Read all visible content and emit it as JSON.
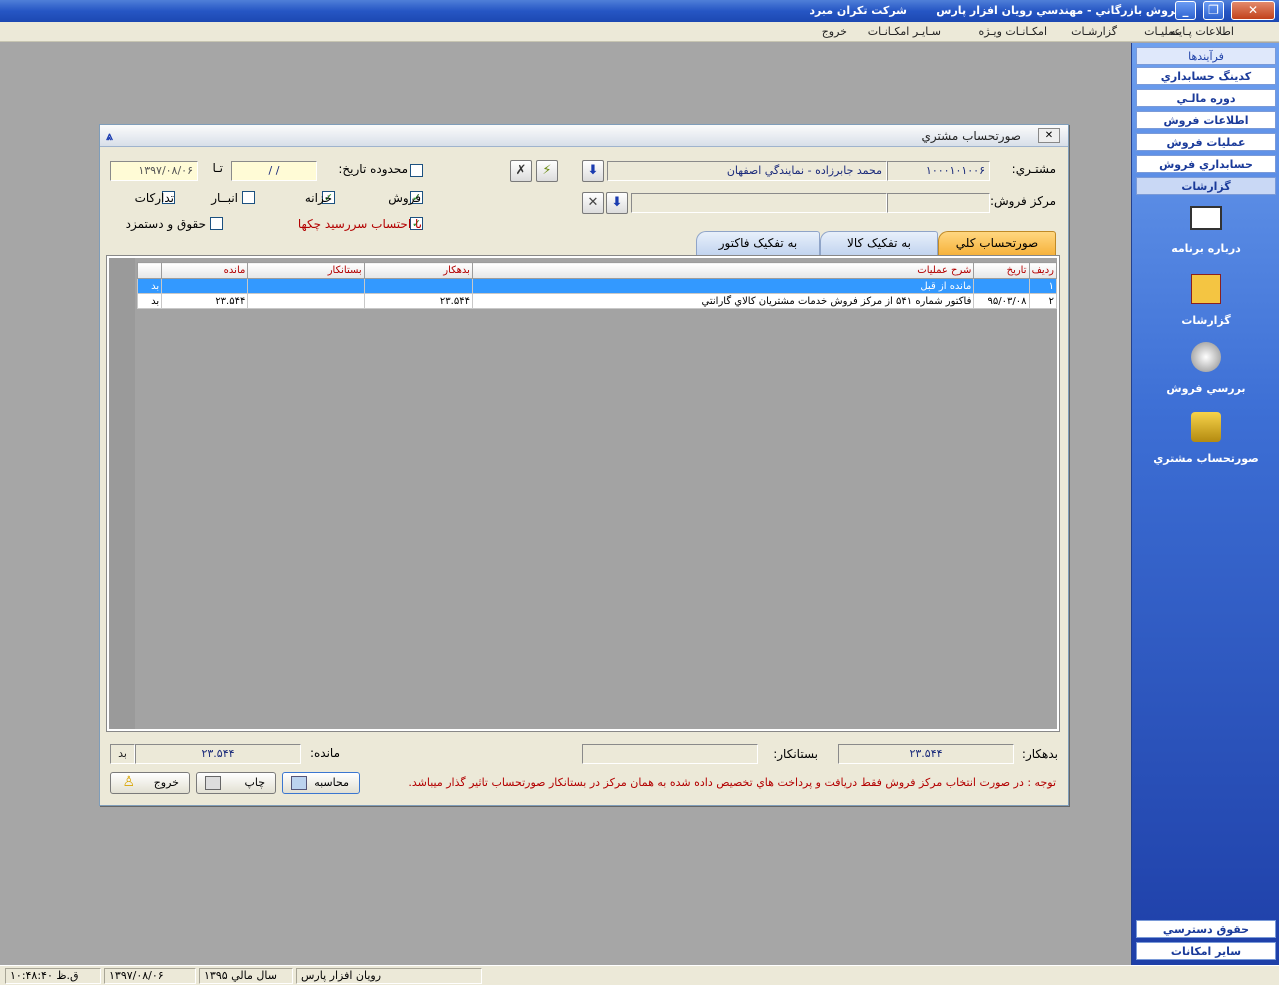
{
  "window": {
    "title": "فروش بازرگاني - مهندسي رويان افزار پارس",
    "company": "شرکت تکران مبرد"
  },
  "menu": [
    "اطلاعات پـايـه",
    "عمليـات",
    "گزارشـات",
    "امکـانـات ويـژه",
    "سـايـر امکـانـات",
    "خروج"
  ],
  "sidebar": {
    "header": "فرآيندها",
    "items": [
      "کدينگ حسابداري",
      "دوره مالـي",
      "اطلاعات فروش",
      "عمليات فروش",
      "حسابداري فروش",
      "گزارشات"
    ],
    "icons": [
      {
        "label": "درباره برنامه",
        "icon": "about-icon"
      },
      {
        "label": "گزارشات",
        "icon": "reports-icon"
      },
      {
        "label": "بررسي فروش",
        "icon": "sales-review-icon"
      },
      {
        "label": "صورتحساب مشتري",
        "icon": "customer-statement-icon"
      }
    ],
    "bottom": [
      "حقوق دسترسي",
      "ساير امکانات"
    ]
  },
  "dialog": {
    "title": "صورتحساب مشتري",
    "customer_label": "مشتـري:",
    "customer_code": "۱۰۰۰۱۰۱۰۰۶",
    "customer_name": "محمد جابرزاده - نمايندگي اصفهان",
    "center_label": "مرکز فروش:",
    "center_code": "",
    "center_name": "",
    "date_range_label": "محدوده تاريخ:",
    "date_from": " /  / ",
    "to_label": "تـا",
    "date_to": "۱۳۹۷/۰۸/۰۶",
    "checks": [
      {
        "label": "فروش",
        "checked": true
      },
      {
        "label": "خزانه",
        "checked": true
      },
      {
        "label": "انبــار",
        "checked": false
      },
      {
        "label": "تدارکات",
        "checked": false
      },
      {
        "label": "با احتساب سررسيد چکها",
        "checked": true
      },
      {
        "label": "حقوق و دستمزد",
        "checked": false
      }
    ],
    "tabs": [
      "صورتحساب کلي",
      "به تفکيک کالا",
      "به تفکيک فاکتور"
    ],
    "grid": {
      "columns": [
        "رديف",
        "تاريخ",
        "شرح عمليات",
        "بدهکار",
        "بستانکار",
        "مانده",
        ""
      ],
      "rows": [
        [
          "۱",
          "",
          "مانده از قبل",
          "",
          "",
          "",
          "بد"
        ],
        [
          "۲",
          "۹۵/۰۳/۰۸",
          "فاکتور شماره ۵۴۱ از مرکز فروش خدمات مشتريان کالاي گارانتي",
          "۲۳.۵۴۴",
          "",
          "۲۳.۵۴۴",
          "بد"
        ]
      ]
    },
    "debit_label": "بدهکار:",
    "debit_value": "۲۳.۵۴۴",
    "credit_label": "بستانکار:",
    "credit_value": "",
    "balance_label": "مانده:",
    "balance_value": "۲۳.۵۴۴",
    "balance_type": "بد",
    "note": "توجه : در صورت انتخاب مرکز فروش فقط دريافت و پرداخت هاي تخصيص داده شده به همان مرکز در بستانکار صورتحساب تاثير گذار ميباشد.",
    "btn_calc": "محاسبه",
    "btn_print": "چاپ",
    "btn_exit": "خروج"
  },
  "status": {
    "app": "رويان افزار پارس",
    "fiscal_year": "سال مالي ۱۳۹۵",
    "date": "۱۳۹۷/۰۸/۰۶",
    "time": "ق.ظ ۱۰:۴۸:۴۰"
  },
  "colors": {
    "accent": "#2656c4",
    "selection": "#3399ff",
    "header_text": "#b30000",
    "note_text": "#b30000"
  }
}
